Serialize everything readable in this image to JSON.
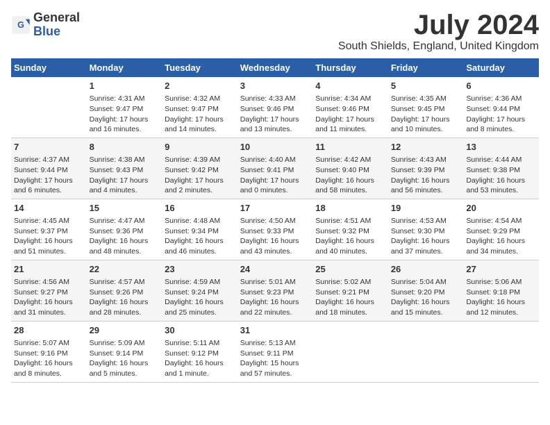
{
  "logo": {
    "general": "General",
    "blue": "Blue"
  },
  "title": "July 2024",
  "location": "South Shields, England, United Kingdom",
  "days_header": [
    "Sunday",
    "Monday",
    "Tuesday",
    "Wednesday",
    "Thursday",
    "Friday",
    "Saturday"
  ],
  "weeks": [
    [
      {
        "day": "",
        "info": ""
      },
      {
        "day": "1",
        "info": "Sunrise: 4:31 AM\nSunset: 9:47 PM\nDaylight: 17 hours\nand 16 minutes."
      },
      {
        "day": "2",
        "info": "Sunrise: 4:32 AM\nSunset: 9:47 PM\nDaylight: 17 hours\nand 14 minutes."
      },
      {
        "day": "3",
        "info": "Sunrise: 4:33 AM\nSunset: 9:46 PM\nDaylight: 17 hours\nand 13 minutes."
      },
      {
        "day": "4",
        "info": "Sunrise: 4:34 AM\nSunset: 9:46 PM\nDaylight: 17 hours\nand 11 minutes."
      },
      {
        "day": "5",
        "info": "Sunrise: 4:35 AM\nSunset: 9:45 PM\nDaylight: 17 hours\nand 10 minutes."
      },
      {
        "day": "6",
        "info": "Sunrise: 4:36 AM\nSunset: 9:44 PM\nDaylight: 17 hours\nand 8 minutes."
      }
    ],
    [
      {
        "day": "7",
        "info": "Sunrise: 4:37 AM\nSunset: 9:44 PM\nDaylight: 17 hours\nand 6 minutes."
      },
      {
        "day": "8",
        "info": "Sunrise: 4:38 AM\nSunset: 9:43 PM\nDaylight: 17 hours\nand 4 minutes."
      },
      {
        "day": "9",
        "info": "Sunrise: 4:39 AM\nSunset: 9:42 PM\nDaylight: 17 hours\nand 2 minutes."
      },
      {
        "day": "10",
        "info": "Sunrise: 4:40 AM\nSunset: 9:41 PM\nDaylight: 17 hours\nand 0 minutes."
      },
      {
        "day": "11",
        "info": "Sunrise: 4:42 AM\nSunset: 9:40 PM\nDaylight: 16 hours\nand 58 minutes."
      },
      {
        "day": "12",
        "info": "Sunrise: 4:43 AM\nSunset: 9:39 PM\nDaylight: 16 hours\nand 56 minutes."
      },
      {
        "day": "13",
        "info": "Sunrise: 4:44 AM\nSunset: 9:38 PM\nDaylight: 16 hours\nand 53 minutes."
      }
    ],
    [
      {
        "day": "14",
        "info": "Sunrise: 4:45 AM\nSunset: 9:37 PM\nDaylight: 16 hours\nand 51 minutes."
      },
      {
        "day": "15",
        "info": "Sunrise: 4:47 AM\nSunset: 9:36 PM\nDaylight: 16 hours\nand 48 minutes."
      },
      {
        "day": "16",
        "info": "Sunrise: 4:48 AM\nSunset: 9:34 PM\nDaylight: 16 hours\nand 46 minutes."
      },
      {
        "day": "17",
        "info": "Sunrise: 4:50 AM\nSunset: 9:33 PM\nDaylight: 16 hours\nand 43 minutes."
      },
      {
        "day": "18",
        "info": "Sunrise: 4:51 AM\nSunset: 9:32 PM\nDaylight: 16 hours\nand 40 minutes."
      },
      {
        "day": "19",
        "info": "Sunrise: 4:53 AM\nSunset: 9:30 PM\nDaylight: 16 hours\nand 37 minutes."
      },
      {
        "day": "20",
        "info": "Sunrise: 4:54 AM\nSunset: 9:29 PM\nDaylight: 16 hours\nand 34 minutes."
      }
    ],
    [
      {
        "day": "21",
        "info": "Sunrise: 4:56 AM\nSunset: 9:27 PM\nDaylight: 16 hours\nand 31 minutes."
      },
      {
        "day": "22",
        "info": "Sunrise: 4:57 AM\nSunset: 9:26 PM\nDaylight: 16 hours\nand 28 minutes."
      },
      {
        "day": "23",
        "info": "Sunrise: 4:59 AM\nSunset: 9:24 PM\nDaylight: 16 hours\nand 25 minutes."
      },
      {
        "day": "24",
        "info": "Sunrise: 5:01 AM\nSunset: 9:23 PM\nDaylight: 16 hours\nand 22 minutes."
      },
      {
        "day": "25",
        "info": "Sunrise: 5:02 AM\nSunset: 9:21 PM\nDaylight: 16 hours\nand 18 minutes."
      },
      {
        "day": "26",
        "info": "Sunrise: 5:04 AM\nSunset: 9:20 PM\nDaylight: 16 hours\nand 15 minutes."
      },
      {
        "day": "27",
        "info": "Sunrise: 5:06 AM\nSunset: 9:18 PM\nDaylight: 16 hours\nand 12 minutes."
      }
    ],
    [
      {
        "day": "28",
        "info": "Sunrise: 5:07 AM\nSunset: 9:16 PM\nDaylight: 16 hours\nand 8 minutes."
      },
      {
        "day": "29",
        "info": "Sunrise: 5:09 AM\nSunset: 9:14 PM\nDaylight: 16 hours\nand 5 minutes."
      },
      {
        "day": "30",
        "info": "Sunrise: 5:11 AM\nSunset: 9:12 PM\nDaylight: 16 hours\nand 1 minute."
      },
      {
        "day": "31",
        "info": "Sunrise: 5:13 AM\nSunset: 9:11 PM\nDaylight: 15 hours\nand 57 minutes."
      },
      {
        "day": "",
        "info": ""
      },
      {
        "day": "",
        "info": ""
      },
      {
        "day": "",
        "info": ""
      }
    ]
  ]
}
